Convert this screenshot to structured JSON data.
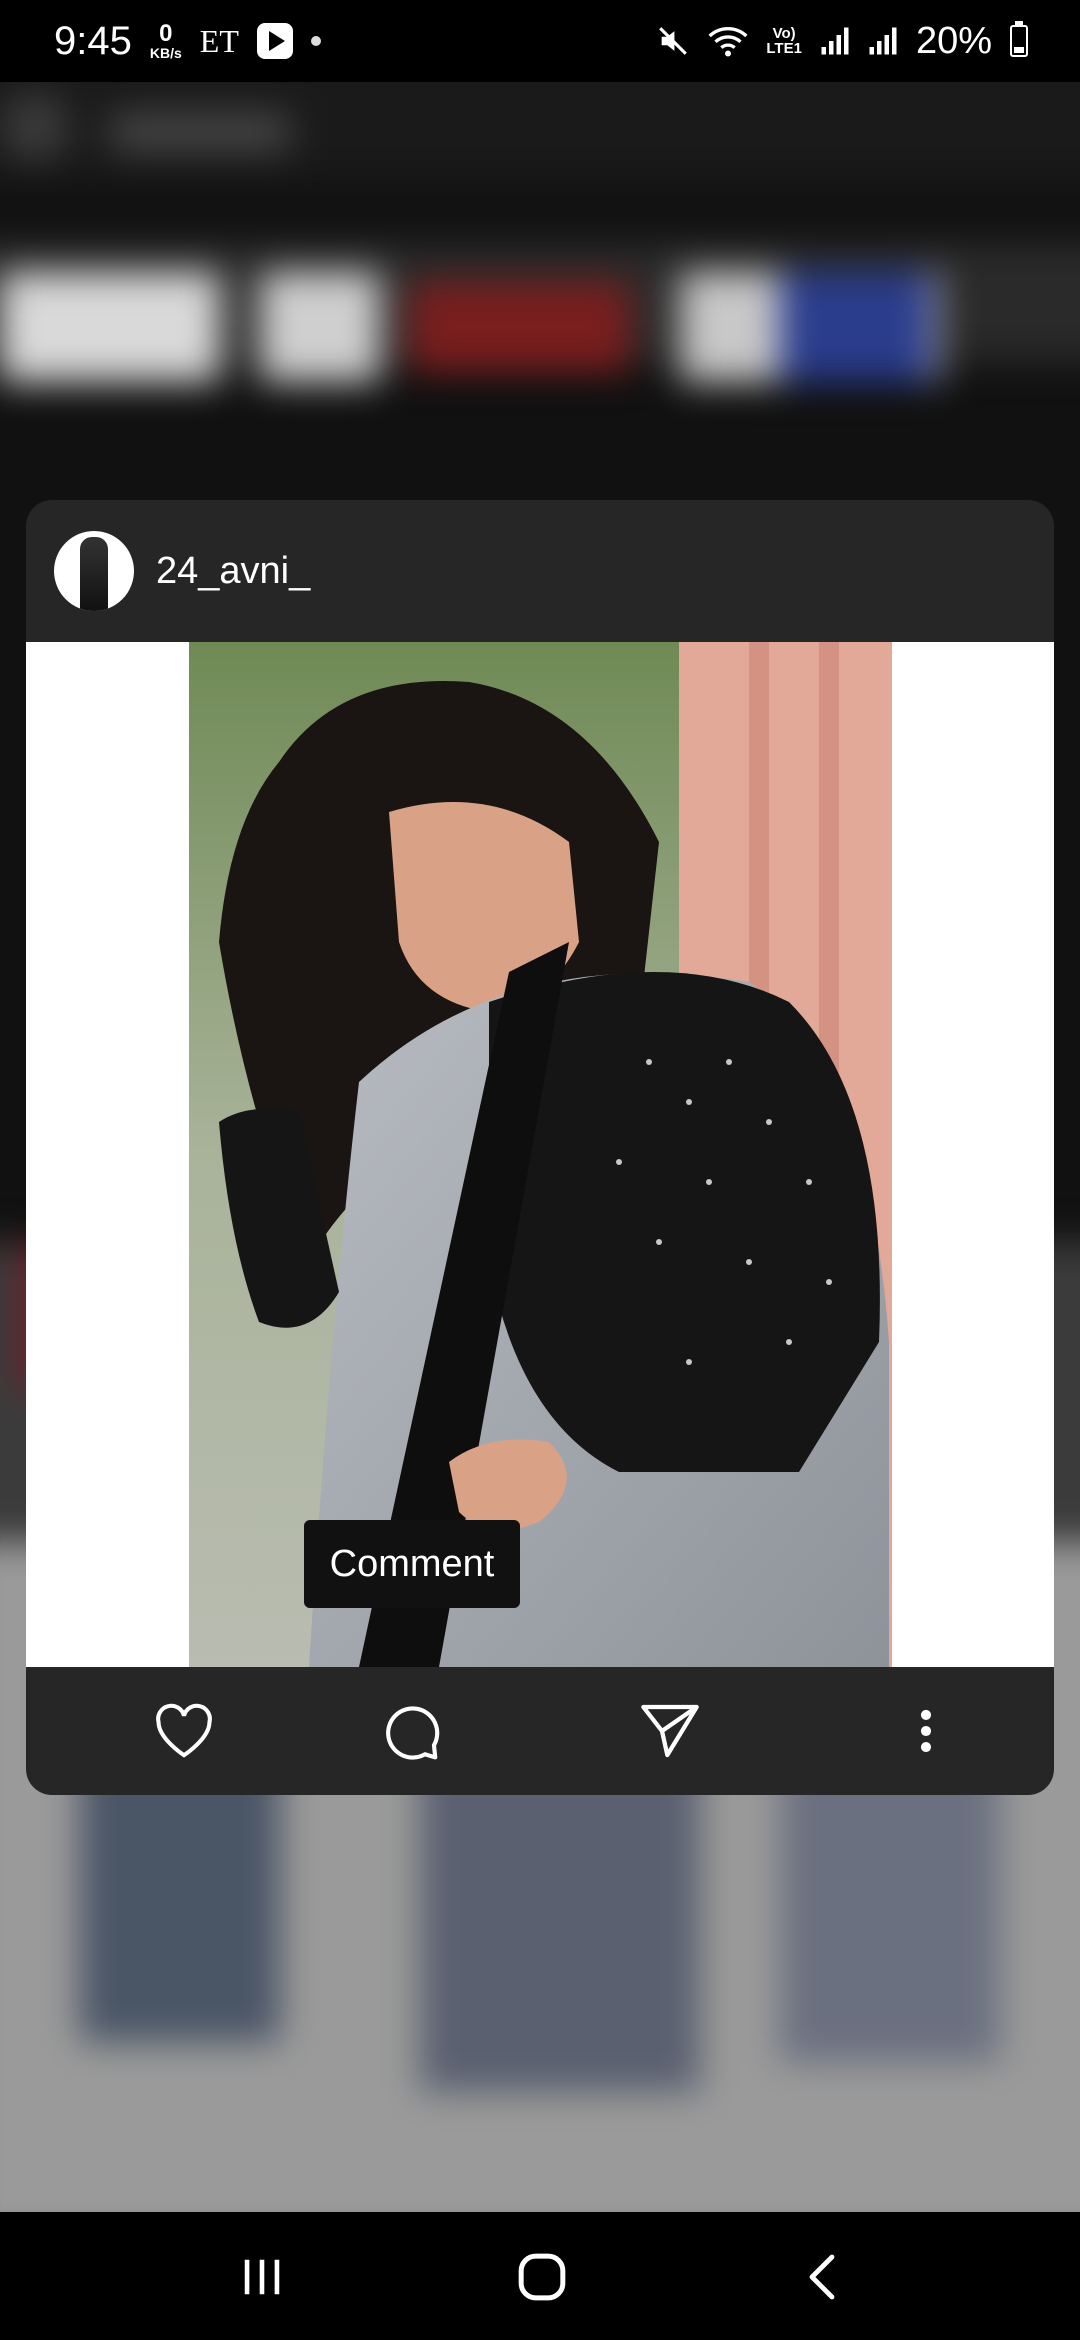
{
  "status_bar": {
    "time": "9:45",
    "net_speed_value": "0",
    "net_speed_unit": "KB/s",
    "carrier_label": "ET",
    "volte_line1": "Vo)",
    "volte_line2": "LTE1",
    "battery": "20%"
  },
  "post": {
    "username": "24_avni_"
  },
  "tooltip": {
    "text": "Comment"
  },
  "actions": {
    "icons": [
      "heart-icon",
      "comment-icon",
      "send-icon",
      "more-vert-icon"
    ]
  },
  "nav": {
    "icons": [
      "recent-apps-icon",
      "home-icon",
      "back-icon"
    ]
  },
  "colors": {
    "card_bg": "#262626",
    "status_bg": "#000000",
    "photo_frame_bg": "#ffffff"
  }
}
